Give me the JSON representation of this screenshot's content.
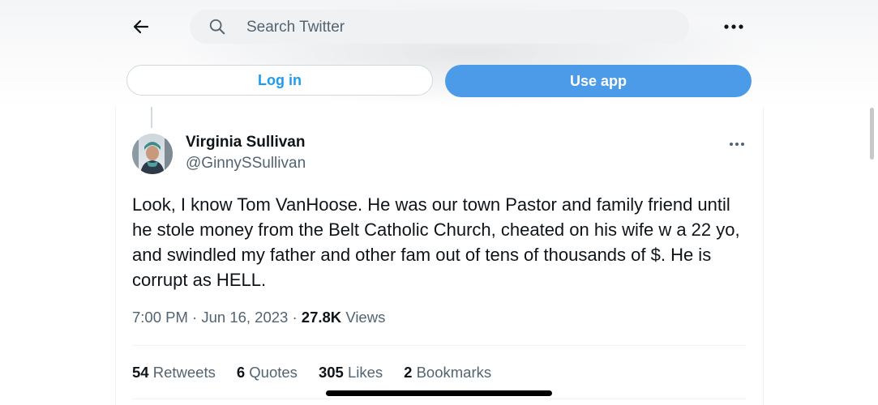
{
  "header": {
    "search_placeholder": "Search Twitter",
    "icons": {
      "back": "arrow-left-icon",
      "search": "search-icon",
      "more": "more-horizontal-icon"
    }
  },
  "auth": {
    "login_label": "Log in",
    "use_app_label": "Use app"
  },
  "tweet": {
    "author_name": "Virginia Sullivan",
    "author_handle": "@GinnySSullivan",
    "text": "Look, I know Tom VanHoose. He was our town Pastor and family friend until he stole money from the Belt Catholic Church, cheated on his wife w a 22 yo, and swindled my father and other fam out of tens of thousands of $. He is corrupt as HELL.",
    "time": "7:00 PM",
    "date": "Jun 16, 2023",
    "separator": "·",
    "views_count": "27.8K",
    "views_label": "Views",
    "stats": [
      {
        "count": "54",
        "label": "Retweets"
      },
      {
        "count": "6",
        "label": "Quotes"
      },
      {
        "count": "305",
        "label": "Likes"
      },
      {
        "count": "2",
        "label": "Bookmarks"
      }
    ]
  },
  "colors": {
    "accent": "#1d9bf0",
    "use_app_bg": "#4c9be8",
    "text_primary": "#0f1419",
    "text_secondary": "#536471",
    "divider": "#eff3f4"
  }
}
